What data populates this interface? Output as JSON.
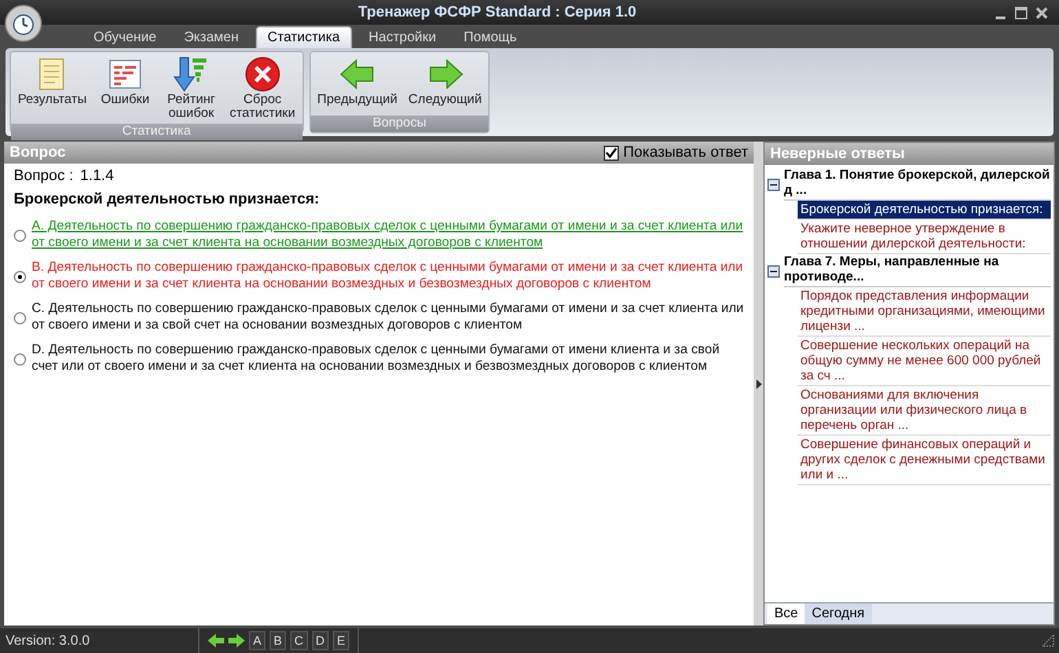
{
  "window": {
    "title": "Тренажер ФСФР Standard : Серия 1.0"
  },
  "tabs": [
    {
      "label": "Обучение",
      "selected": false
    },
    {
      "label": "Экзамен",
      "selected": false
    },
    {
      "label": "Статистика",
      "selected": true
    },
    {
      "label": "Настройки",
      "selected": false
    },
    {
      "label": "Помощь",
      "selected": false
    }
  ],
  "ribbon": [
    {
      "title": "Статистика",
      "buttons": [
        {
          "kind": "results",
          "label": "Результаты"
        },
        {
          "kind": "errors",
          "label": "Ошибки"
        },
        {
          "kind": "rating",
          "label": "Рейтинг ошибок"
        },
        {
          "kind": "reset",
          "label": "Сброс статистики"
        }
      ]
    },
    {
      "title": "Вопросы",
      "buttons": [
        {
          "kind": "prev",
          "label": "Предыдущий"
        },
        {
          "kind": "next",
          "label": "Следующий"
        }
      ]
    }
  ],
  "question_panel": {
    "title": "Вопрос",
    "show_answer": {
      "label": "Показывать ответ",
      "checked": true
    },
    "number_label": "Вопрос :",
    "number": "1.1.4",
    "question": "Брокерской деятельностью признается:",
    "answers": [
      {
        "text": "A. Деятельность по совершению гражданско-правовых сделок с ценными бумагами от имени и за счет клиента или от своего имени и за счет клиента на основании возмездных договоров с клиентом",
        "selected": false,
        "correct": true
      },
      {
        "text": "B. Деятельность по совершению гражданско-правовых сделок с ценными бумагами от имени и за счет клиента или от своего имени и за счет клиента на основании возмездных и безвозмездных договоров с клиентом",
        "selected": true,
        "correct": false
      },
      {
        "text": "C. Деятельность по совершению гражданско-правовых сделок с ценными бумагами от имени и за счет клиента или от своего имени и за свой счет на основании возмездных договоров с клиентом",
        "selected": false,
        "correct": false
      },
      {
        "text": "D. Деятельность по совершению гражданско-правовых сделок с ценными бумагами от имени клиента и за свой счет или от своего имени и за счет клиента на основании возмездных и безвозмездных договоров с клиентом",
        "selected": false,
        "correct": false
      }
    ]
  },
  "wrong_answers_panel": {
    "title": "Неверные ответы",
    "tree": [
      {
        "label": "Глава 1. Понятие брокерской, дилерской д ...",
        "expanded": true,
        "children": [
          {
            "label": "Брокерской деятельностью признается:",
            "selected": true
          },
          {
            "label": "Укажите неверное утверждение в отношении дилерской деятельности:",
            "selected": false
          }
        ]
      },
      {
        "label": "Глава 7. Меры, направленные на противоде...",
        "expanded": true,
        "children": [
          {
            "label": "Порядок представления информации кредитными организациями, имеющими лицензи ...",
            "selected": false
          },
          {
            "label": "Совершение нескольких операций на общую сумму не менее 600 000 рублей за сч ...",
            "selected": false
          },
          {
            "label": "Основаниями для включения организации или физического лица в перечень орган ...",
            "selected": false
          },
          {
            "label": "Совершение финансовых операций и других сделок с денежными средствами или и ...",
            "selected": false
          }
        ]
      }
    ],
    "bottom_tabs": [
      {
        "label": "Все",
        "selected": true
      },
      {
        "label": "Сегодня",
        "selected": false
      }
    ]
  },
  "status_bar": {
    "version": "Version: 3.0.0",
    "letters": [
      "A",
      "B",
      "C",
      "D",
      "E"
    ]
  }
}
